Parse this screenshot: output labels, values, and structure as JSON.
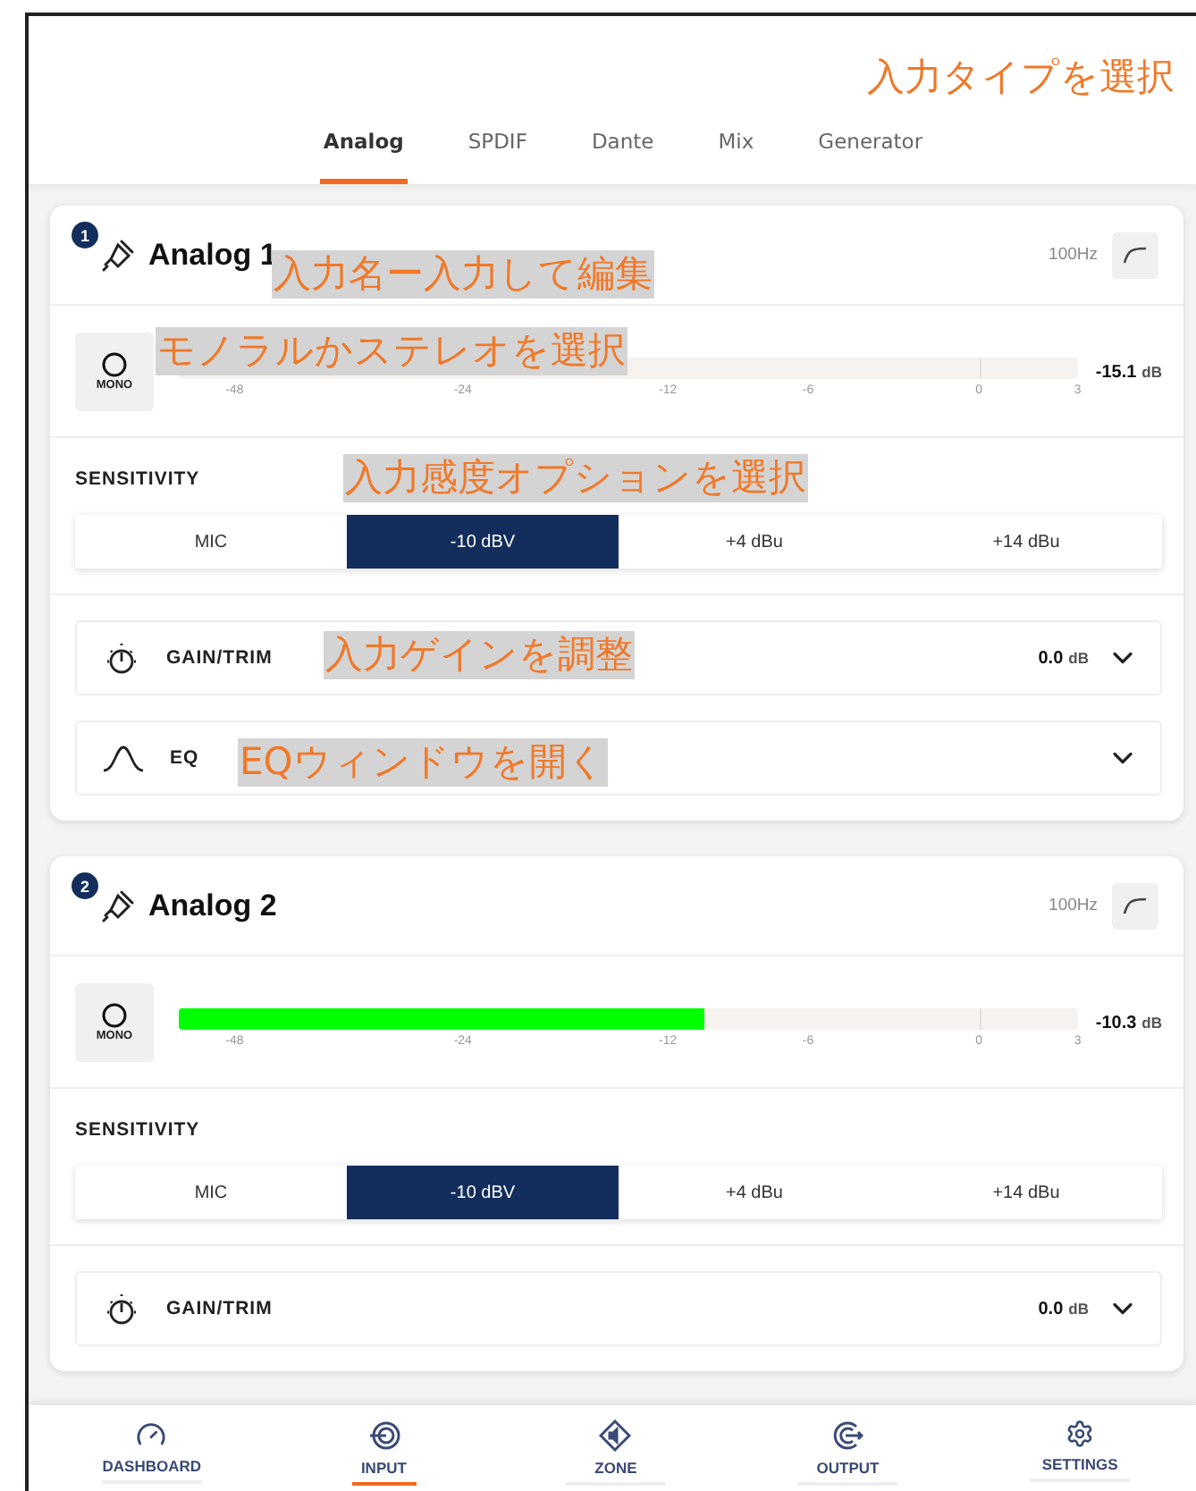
{
  "tabs": [
    {
      "label": "Analog",
      "selected": true
    },
    {
      "label": "SPDIF",
      "selected": false
    },
    {
      "label": "Dante",
      "selected": false
    },
    {
      "label": "Mix",
      "selected": false
    },
    {
      "label": "Generator",
      "selected": false
    }
  ],
  "channels": [
    {
      "number": "1",
      "name": "Analog 1",
      "filter": "100Hz",
      "mode": "MONO",
      "reading": "-15.1",
      "reading_unit": "dB",
      "scale": [
        "-48",
        "-24",
        "-12",
        "-6",
        "0",
        "3"
      ],
      "sensitivity_label": "SENSITIVITY",
      "sensitivity": [
        {
          "label": "MIC",
          "selected": false
        },
        {
          "label": "-10 dBV",
          "selected": true
        },
        {
          "label": "+4 dBu",
          "selected": false
        },
        {
          "label": "+14 dBu",
          "selected": false
        }
      ],
      "rows": [
        {
          "kind": "gain",
          "label": "GAIN/TRIM",
          "value": "0.0",
          "unit": "dB"
        },
        {
          "kind": "eq",
          "label": "EQ"
        }
      ]
    },
    {
      "number": "2",
      "name": "Analog 2",
      "filter": "100Hz",
      "mode": "MONO",
      "level": 0.585,
      "reading": "-10.3",
      "reading_unit": "dB",
      "scale": [
        "-48",
        "-24",
        "-12",
        "-6",
        "0",
        "3"
      ],
      "sensitivity_label": "SENSITIVITY",
      "sensitivity": [
        {
          "label": "MIC",
          "selected": false
        },
        {
          "label": "-10 dBV",
          "selected": true
        },
        {
          "label": "+4 dBu",
          "selected": false
        },
        {
          "label": "+14 dBu",
          "selected": false
        }
      ],
      "rows": [
        {
          "kind": "gain",
          "label": "GAIN/TRIM",
          "value": "0.0",
          "unit": "dB"
        }
      ]
    }
  ],
  "nav": [
    {
      "label": "DASHBOARD",
      "selected": false
    },
    {
      "label": "INPUT",
      "selected": true
    },
    {
      "label": "ZONE",
      "selected": false
    },
    {
      "label": "OUTPUT",
      "selected": false
    },
    {
      "label": "SETTINGS",
      "selected": false
    }
  ],
  "annotations": [
    {
      "text": "入力タイプを選択",
      "highlighted": false
    },
    {
      "text": "入力名ー入力して編集",
      "highlighted": true
    },
    {
      "text": "モノラルかステレオを選択",
      "highlighted": true
    },
    {
      "text": "入力感度オプションを選択",
      "highlighted": true
    },
    {
      "text": "入力ゲインを調整",
      "highlighted": true
    },
    {
      "text": "EQウィンドウを開く",
      "highlighted": true
    }
  ]
}
